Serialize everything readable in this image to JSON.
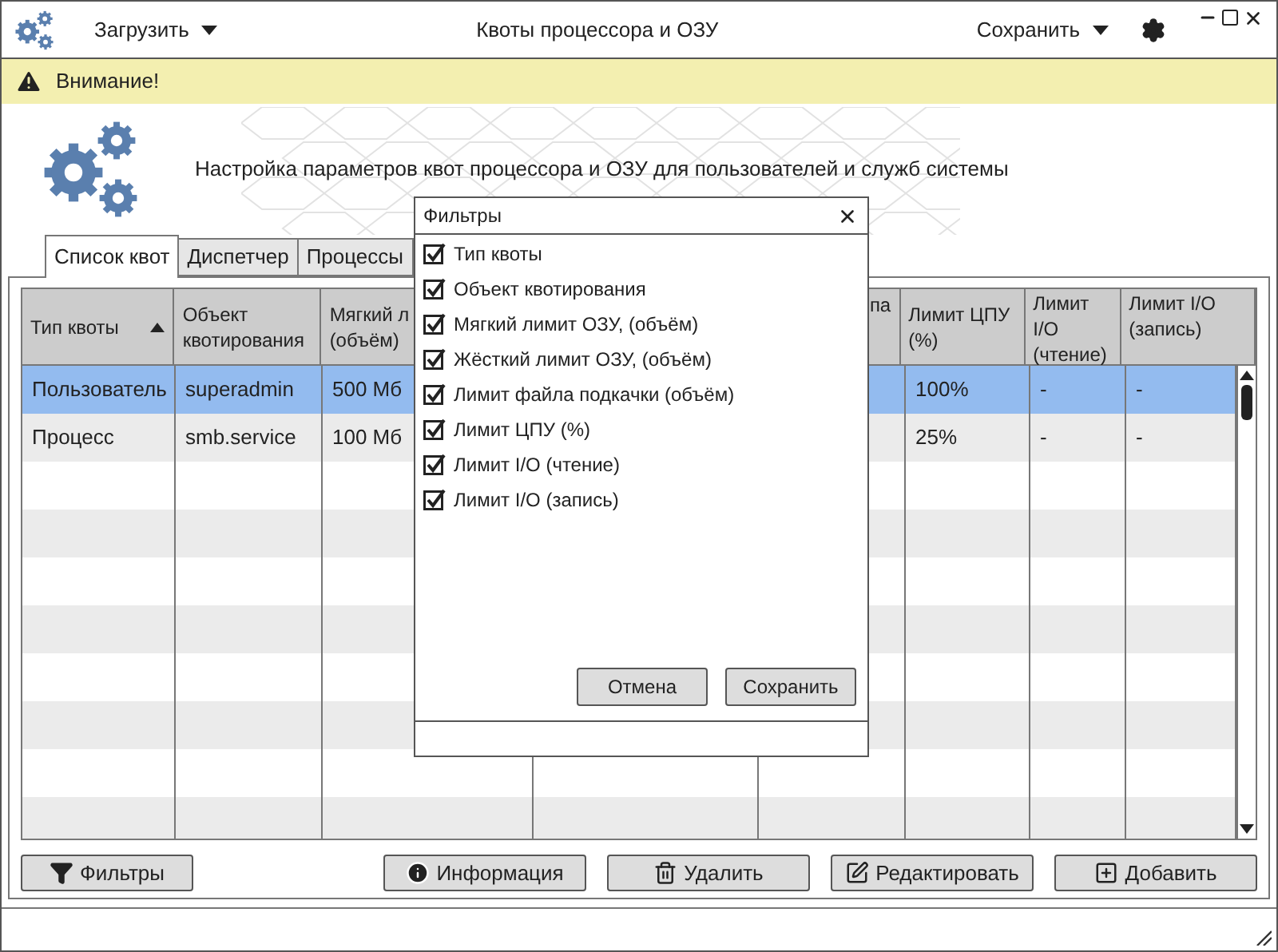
{
  "window": {
    "title": "Квоты процессора и ОЗУ",
    "menus": [
      {
        "label": "Загрузить"
      },
      {
        "label": "Сохранить"
      }
    ]
  },
  "alert": {
    "text": "Внимание!"
  },
  "heading": "Настройка параметров квот процессора и ОЗУ для пользователей и служб системы",
  "tabs": [
    {
      "label": "Список квот",
      "selected": true
    },
    {
      "label": "Диспетчер",
      "selected": false
    },
    {
      "label": "Процессы",
      "selected": false
    }
  ],
  "table": {
    "sort_ascending": true,
    "columns": [
      {
        "label": "Тип квоты"
      },
      {
        "label": "Объект квотирования"
      },
      {
        "label": "Мягкий л (объём)"
      },
      {
        "label": "па"
      },
      {
        "label": "Лимит ЦПУ (%)"
      },
      {
        "label": "Лимит I/O (чтение)"
      },
      {
        "label": "Лимит I/O (запись)"
      }
    ],
    "rows": [
      {
        "selected": true,
        "cells": [
          "Пользователь",
          "superadmin",
          "500 Мб",
          null,
          "100%",
          "-",
          "-"
        ]
      },
      {
        "selected": false,
        "cells": [
          "Процесс",
          "smb.service",
          "100 Мб",
          null,
          "25%",
          "-",
          "-"
        ]
      }
    ]
  },
  "buttons": [
    {
      "label": "Фильтры",
      "kind": "filter"
    },
    {
      "label": "Информация",
      "kind": "info"
    },
    {
      "label": "Удалить",
      "kind": "delete"
    },
    {
      "label": "Редактировать",
      "kind": "edit"
    },
    {
      "label": "Добавить",
      "kind": "add"
    }
  ],
  "dialog": {
    "title": "Фильтры",
    "items": [
      {
        "label": "Тип квоты",
        "checked": true
      },
      {
        "label": "Объект квотирования",
        "checked": true
      },
      {
        "label": "Мягкий лимит ОЗУ, (объём)",
        "checked": true
      },
      {
        "label": "Жёсткий лимит ОЗУ, (объём)",
        "checked": true
      },
      {
        "label": "Лимит файла подкачки (объём)",
        "checked": true
      },
      {
        "label": "Лимит ЦПУ (%)",
        "checked": true
      },
      {
        "label": "Лимит I/O (чтение)",
        "checked": true
      },
      {
        "label": "Лимит I/O (запись)",
        "checked": true
      }
    ],
    "buttons": [
      "Отмена",
      "Сохранить"
    ]
  }
}
